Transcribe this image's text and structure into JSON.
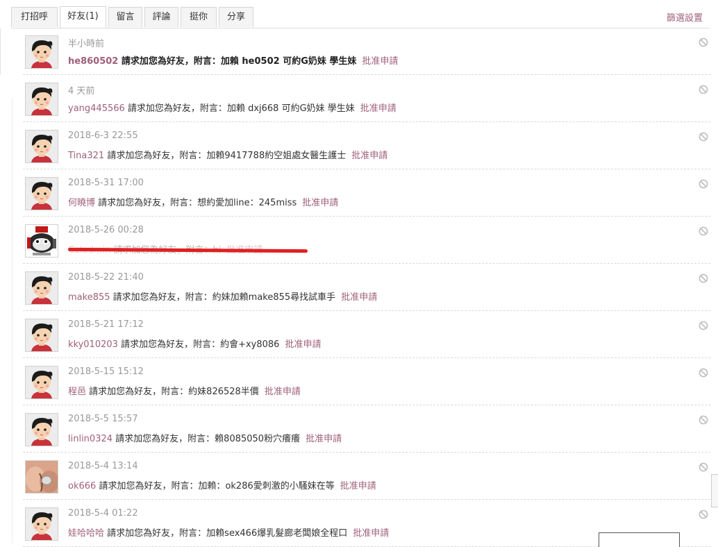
{
  "tabs": [
    {
      "label": "打招呼"
    },
    {
      "label": "好友(1)"
    },
    {
      "label": "留言"
    },
    {
      "label": "評論"
    },
    {
      "label": "挺你"
    },
    {
      "label": "分享"
    }
  ],
  "filter_label": "篩選設置",
  "request_text": "請求加您為好友，附言：",
  "approve_label": "批准申請",
  "requests": [
    {
      "time": "半小時前",
      "username": "he860502",
      "message": "加賴 he0502 可約G奶妹 學生妹",
      "avatar": "cartoon",
      "bold": true
    },
    {
      "time": "4 天前",
      "username": "yang445566",
      "message": "加賴 dxj668 可約G奶妹 學生妹",
      "avatar": "cartoon"
    },
    {
      "time": "2018-6-3 22:55",
      "username": "Tina321",
      "message": "加賴9417788約空姐處女醫生護士",
      "avatar": "cartoon"
    },
    {
      "time": "2018-5-31 17:00",
      "username": "何曉博",
      "message": "想約愛加line：245miss",
      "avatar": "cartoon"
    },
    {
      "time": "2018-5-26 00:28",
      "username": "Coladmin",
      "message": "hi",
      "avatar": "mascot",
      "redacted": true
    },
    {
      "time": "2018-5-22 21:40",
      "username": "make855",
      "message": "約妹加賴make855尋找試車手",
      "avatar": "cartoon"
    },
    {
      "time": "2018-5-21 17:12",
      "username": "kky010203",
      "message": "約會+xy8086",
      "avatar": "cartoon"
    },
    {
      "time": "2018-5-15 15:12",
      "username": "程邑",
      "message": "約妹826528半價",
      "avatar": "cartoon"
    },
    {
      "time": "2018-5-5 15:57",
      "username": "linlin0324",
      "message": "賴8085050粉穴癢癢",
      "avatar": "cartoon"
    },
    {
      "time": "2018-5-4 13:14",
      "username": "ok666",
      "message": "加賴：ok286愛刺激的小騷妹在等",
      "avatar": "photo"
    },
    {
      "time": "2018-5-4 01:22",
      "username": "娃哈哈哈",
      "message": "加賴sex466爆乳髮廊老闆娘全程口",
      "avatar": "cartoon"
    }
  ]
}
